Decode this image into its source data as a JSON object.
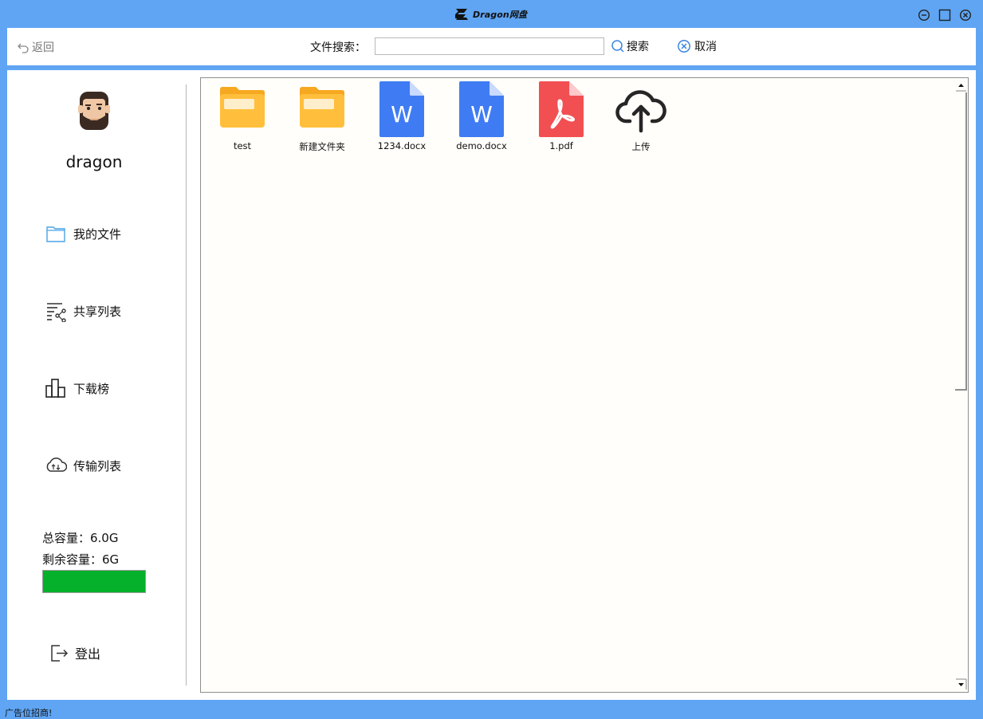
{
  "window": {
    "title": "Dragon网盘",
    "controls": [
      "minimize-icon",
      "maximize-icon",
      "close-icon"
    ]
  },
  "toolbar": {
    "back_label": "返回",
    "search_label": "文件搜索：",
    "search_value": "",
    "search_button": "搜索",
    "cancel_button": "取消"
  },
  "sidebar": {
    "username": "dragon",
    "items": [
      {
        "label": "我的文件",
        "icon": "folder-icon"
      },
      {
        "label": "共享列表",
        "icon": "share-list-icon"
      },
      {
        "label": "下载榜",
        "icon": "bar-chart-icon"
      },
      {
        "label": "传输列表",
        "icon": "cloud-transfer-icon"
      }
    ],
    "total_capacity": "总容量：6.0G",
    "remaining_capacity": "剩余容量：6G",
    "capacity_remaining_fraction": 1.0,
    "capacity_color": "#05b02a",
    "logout_label": "登出"
  },
  "files": [
    {
      "name": "test",
      "type": "folder"
    },
    {
      "name": "新建文件夹",
      "type": "folder"
    },
    {
      "name": "1234.docx",
      "type": "docx"
    },
    {
      "name": "demo.docx",
      "type": "docx"
    },
    {
      "name": "1.pdf",
      "type": "pdf"
    },
    {
      "name": "上传",
      "type": "upload"
    }
  ],
  "colors": {
    "accent": "#5fa5f3",
    "folder": "#ffbf3c",
    "docx": "#3f7cf4",
    "pdf": "#f24f53"
  },
  "statusbar": {
    "text": "广告位招商!"
  }
}
